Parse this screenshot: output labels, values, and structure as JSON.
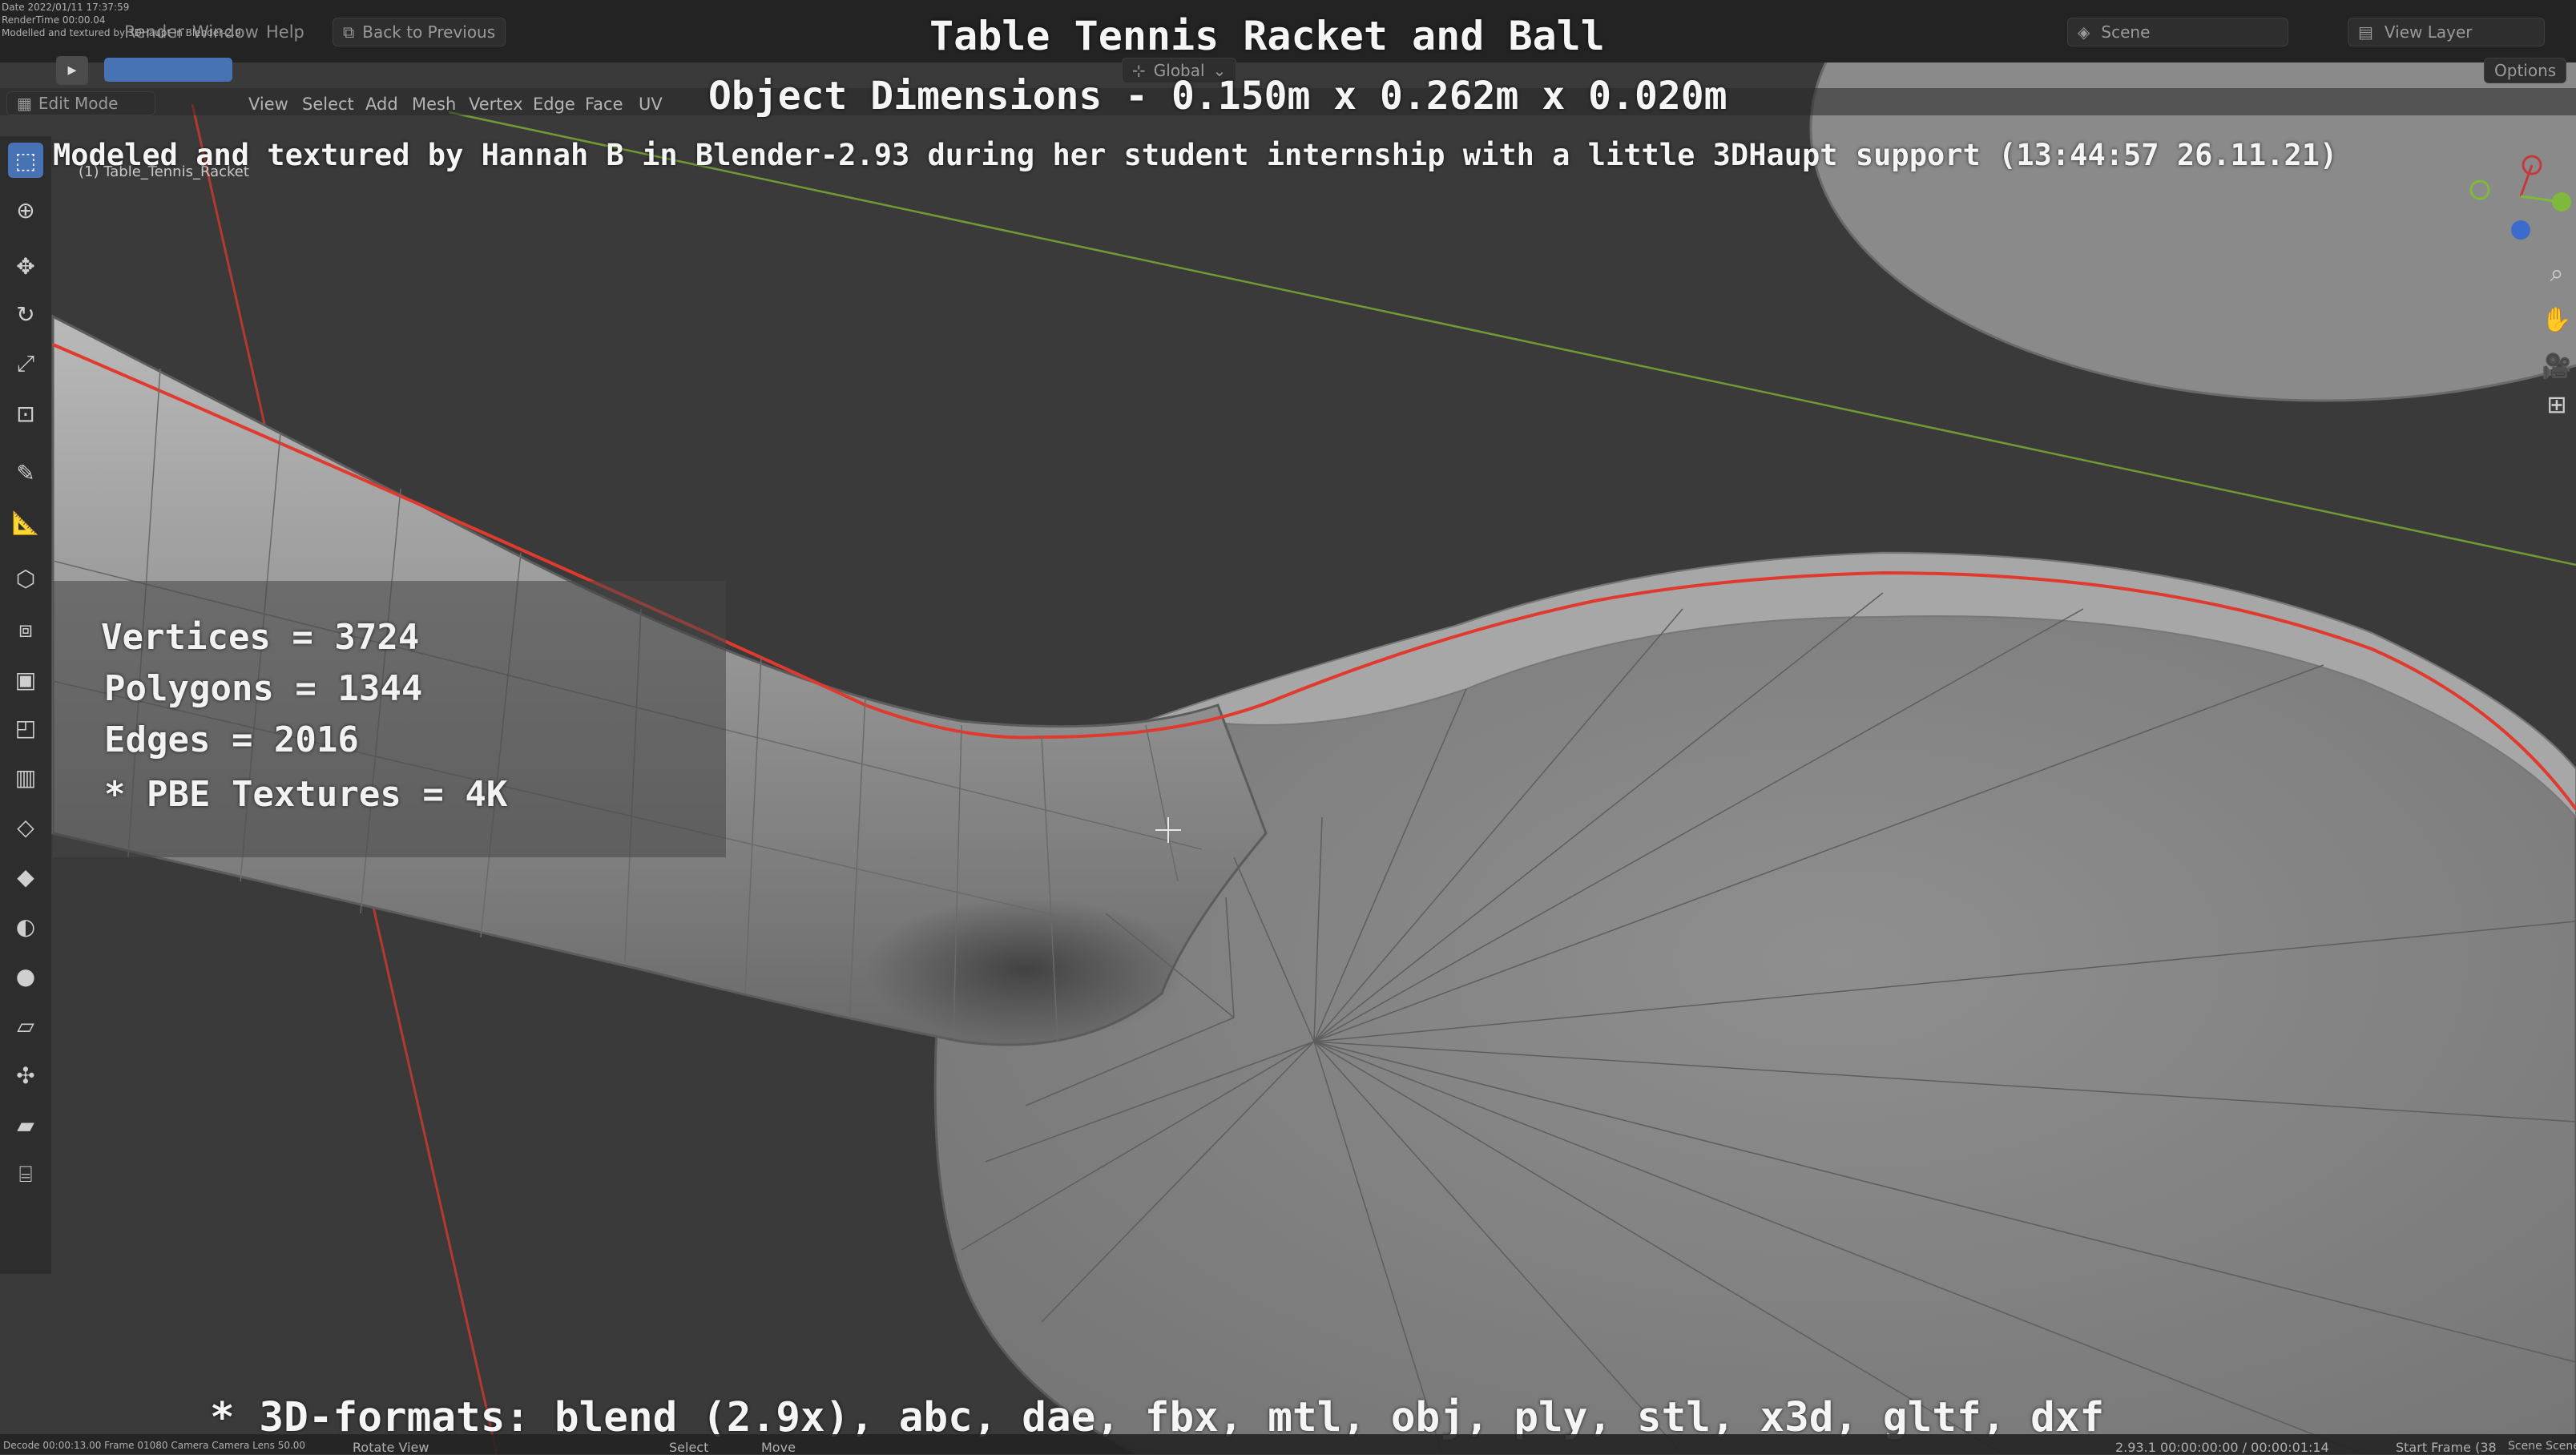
{
  "title": "Table Tennis Racket and Ball",
  "dimensions": "Object Dimensions -  0.150m x 0.262m x 0.020m",
  "credit": "Modeled and textured by Hannah B in Blender-2.93 during her student internship with a little 3DHaupt support (13:44:57 26.11.21)",
  "stats": {
    "vertices": "Vertices = 3724",
    "polygons": "Polygons = 1344",
    "edges": "Edges = 2016",
    "textures": "* PBE Textures = 4K"
  },
  "formats": "* 3D-formats: blend (2.9x), abc, dae, fbx, mtl, obj, ply, stl, x3d, gltf, dxf",
  "overlay_small": {
    "date": "Date 2022/01/11 17:37:59",
    "rendertime": "RenderTime 00:00.04",
    "note": "Modelled and textured by 3DHaupt in Blender-2.9"
  },
  "menu": {
    "render": "Render",
    "window": "Window",
    "help": "Help",
    "back": "Back to Previous"
  },
  "header2": {
    "mode": "Edit Mode",
    "view": "View",
    "select": "Select",
    "add": "Add",
    "mesh": "Mesh",
    "vertex": "Vertex",
    "edge": "Edge",
    "face": "Face",
    "uv": "UV"
  },
  "top_right": {
    "scene": "Scene",
    "view_layer": "View Layer",
    "options": "Options",
    "global": "Global"
  },
  "object_label": "(1) Table_Tennis_Racket",
  "status": {
    "left": "Decode 00:00:13.00  Frame 01080  Camera Camera  Lens 50.00",
    "rotate": "Rotate View",
    "select": "Select",
    "move": "Move",
    "right": "2.93.1  00:00:00:00 / 00:00:01:14",
    "frame": "Start Frame (38",
    "scene": "Scene Scene"
  },
  "colors": {
    "background": "#3a3a3a",
    "mesh": "#8f8f8f",
    "seam": "#e03a2f",
    "axis_x": "#c0392b",
    "axis_y": "#8ac13a",
    "active_tool": "#4772b3"
  }
}
